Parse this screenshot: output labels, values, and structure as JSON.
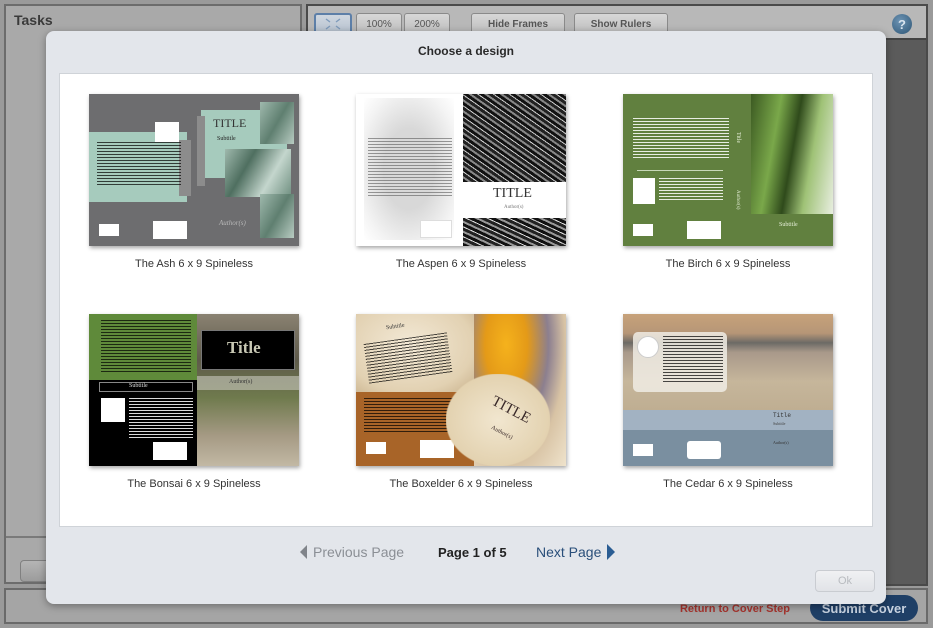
{
  "app": {
    "tasks_title": "Tasks",
    "toolbar": {
      "fit_label": "",
      "zoom_100": "100%",
      "zoom_200": "200%",
      "hide_frames": "Hide Frames",
      "show_rulers": "Show Rulers",
      "help": "?"
    },
    "bottom": {
      "return_link": "Return to Cover Step",
      "submit": "Submit Cover"
    }
  },
  "modal": {
    "title": "Choose a design",
    "designs": [
      {
        "name": "The Ash 6 x 9 Spineless",
        "title_text": "TITLE",
        "subtitle_text": "Subtitle",
        "author_text": "Author(s)"
      },
      {
        "name": "The Aspen 6 x 9 Spineless",
        "title_text": "TITLE",
        "author_text": "Author(s)"
      },
      {
        "name": "The Birch 6 x 9 Spineless",
        "title_text": "Title",
        "subtitle_text": "Subtitle",
        "author_text": "Author(s)"
      },
      {
        "name": "The Bonsai 6 x 9 Spineless",
        "title_text": "Title",
        "subtitle_text": "Subtitle",
        "author_text": "Author(s)"
      },
      {
        "name": "The Boxelder 6 x 9 Spineless",
        "title_text": "TITLE",
        "subtitle_text": "Subtitle",
        "author_text": "Author(s)"
      },
      {
        "name": "The Cedar 6 x 9 Spineless",
        "title_text": "Title",
        "subtitle_text": "Subtitle",
        "author_text": "Author(s)"
      }
    ],
    "pager": {
      "previous": "Previous Page",
      "indicator": "Page 1 of 5",
      "next": "Next Page"
    },
    "ok": "Ok"
  },
  "colors": {
    "submit_bg": "#1f3f66",
    "next_link": "#2a4f7a",
    "return_link": "#a5342e"
  }
}
